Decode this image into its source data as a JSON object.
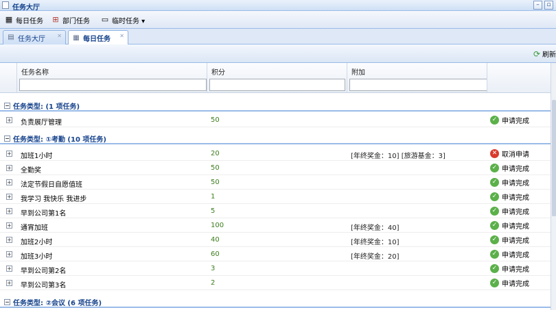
{
  "window": {
    "title": "任务大厅"
  },
  "toolbar": {
    "daily": "每日任务",
    "dept": "部门任务",
    "temp": "临时任务 ▾"
  },
  "tabs": [
    {
      "label": "任务大厅"
    },
    {
      "label": "每日任务"
    }
  ],
  "grid_toolbar": {
    "refresh": "刷新"
  },
  "columns": {
    "name": "任务名称",
    "score": "积分",
    "extra": "附加"
  },
  "groups": [
    {
      "title": "任务类型: (1 项任务)",
      "rows": [
        {
          "name": "负责展厅管理",
          "score": "50",
          "extra": "",
          "action": "申请完成",
          "status": "ok"
        }
      ]
    },
    {
      "title": "任务类型: ①考勤 (10 项任务)",
      "rows": [
        {
          "name": "加班1小时",
          "score": "20",
          "extra": "[年终奖金：10] [旅游基金：3]",
          "action": "取消申请",
          "status": "no"
        },
        {
          "name": "全勤奖",
          "score": "50",
          "extra": "",
          "action": "申请完成",
          "status": "ok"
        },
        {
          "name": "法定节假日自愿值班",
          "score": "50",
          "extra": "",
          "action": "申请完成",
          "status": "ok"
        },
        {
          "name": "我学习 我快乐 我进步",
          "score": "1",
          "extra": "",
          "action": "申请完成",
          "status": "ok"
        },
        {
          "name": "早到公司第1名",
          "score": "5",
          "extra": "",
          "action": "申请完成",
          "status": "ok"
        },
        {
          "name": "通宵加班",
          "score": "100",
          "extra": "[年终奖金：40]",
          "action": "申请完成",
          "status": "ok"
        },
        {
          "name": "加班2小时",
          "score": "40",
          "extra": "[年终奖金：10]",
          "action": "申请完成",
          "status": "ok"
        },
        {
          "name": "加班3小时",
          "score": "60",
          "extra": "[年终奖金：20]",
          "action": "申请完成",
          "status": "ok"
        },
        {
          "name": "早到公司第2名",
          "score": "3",
          "extra": "",
          "action": "申请完成",
          "status": "ok"
        },
        {
          "name": "早到公司第3名",
          "score": "2",
          "extra": "",
          "action": "申请完成",
          "status": "ok"
        }
      ]
    },
    {
      "title": "任务类型: ②会议 (6 项任务)",
      "rows": []
    }
  ]
}
